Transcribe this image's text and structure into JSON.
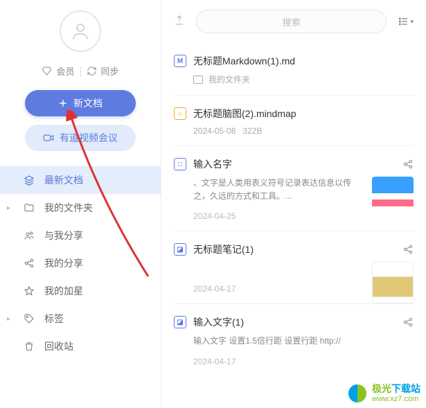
{
  "sidebar": {
    "member_label": "会员",
    "sync_label": "同步",
    "new_doc_label": "新文档",
    "video_meeting_label": "有道视频会议",
    "nav": {
      "recent": "最新文档",
      "myfiles": "我的文件夹",
      "shared_with_me": "与我分享",
      "my_shares": "我的分享",
      "starred": "我的加星",
      "tags": "标签",
      "trash": "回收站"
    }
  },
  "toolbar": {
    "search_placeholder": "搜索"
  },
  "docs": [
    {
      "title": "无标题Markdown(1).md",
      "icon_type": "M",
      "icon_color": "blue",
      "folder_label": "我的文件夹"
    },
    {
      "title": "无标题脑图(2).mindmap",
      "icon_type": "☼",
      "icon_color": "orange",
      "date": "2024-05-08",
      "size": "322B"
    },
    {
      "title": "输入名字",
      "icon_type": "□",
      "icon_color": "blue",
      "preview": "、文字是人类用表义符号记录表达信息以传之，久远的方式和工具。...",
      "date": "2024-04-25",
      "share": true,
      "thumb": "doraemon"
    },
    {
      "title": "无标题笔记(1)",
      "icon_type": "◪",
      "icon_color": "blue",
      "date": "2024-04-17",
      "share": true,
      "thumb": "gold"
    },
    {
      "title": "输入文字(1)",
      "icon_type": "◪",
      "icon_color": "blue",
      "preview": "输入文字 设置1.5倍行距 设置行距 http://",
      "date": "2024-04-17",
      "share": true
    }
  ],
  "watermark": {
    "cn_g": "极光",
    "cn_b": "下载站",
    "url": "www.xz7.com"
  }
}
